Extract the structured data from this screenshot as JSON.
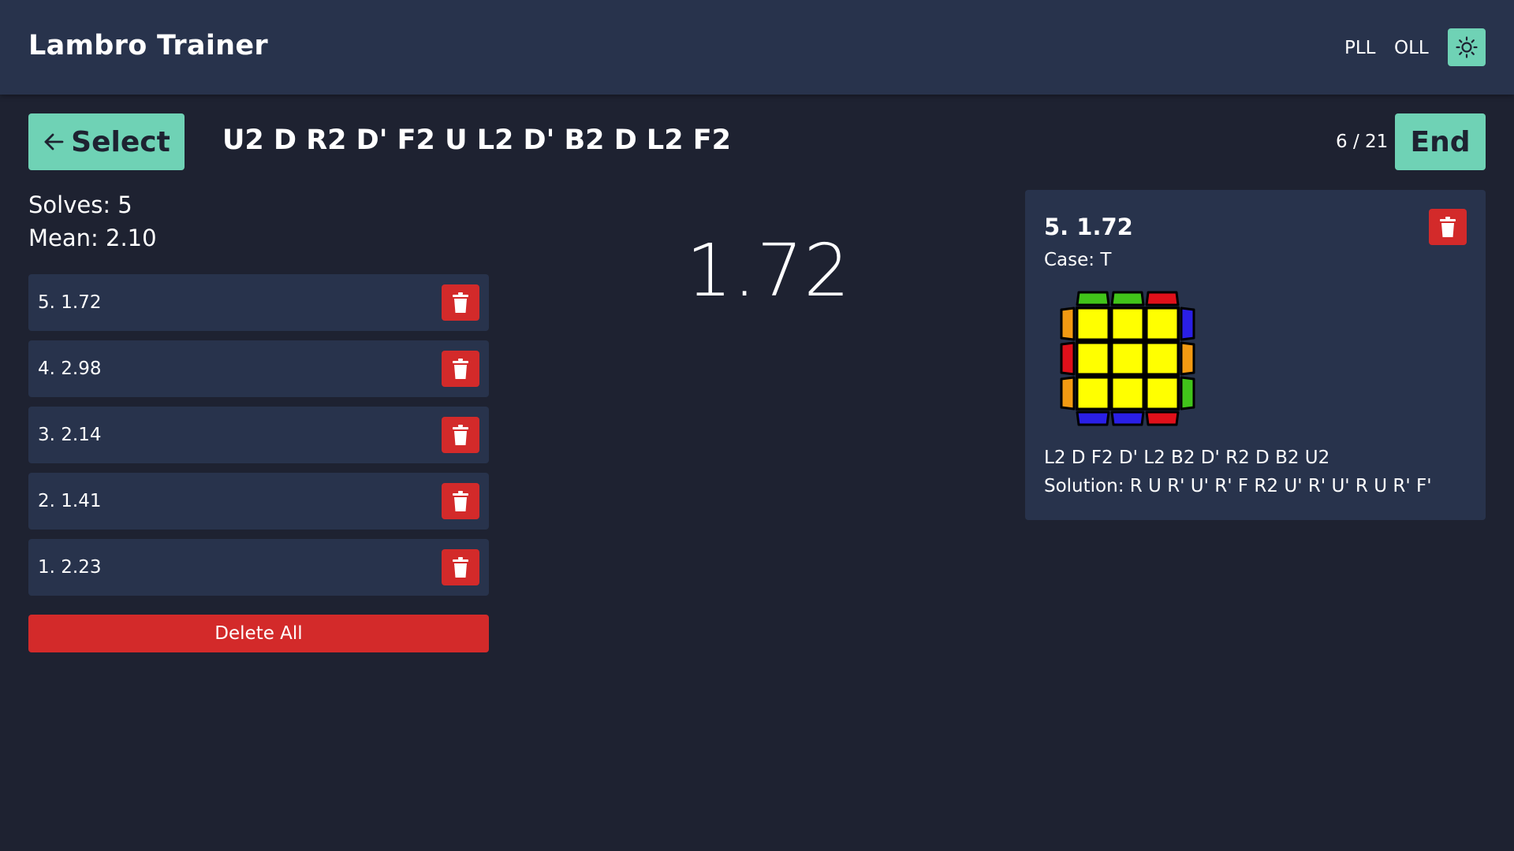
{
  "header": {
    "title": "Lambro Trainer",
    "nav": [
      "PLL",
      "OLL"
    ],
    "theme_icon": "sun-icon"
  },
  "toolbar": {
    "select_label": "Select",
    "scramble": "U2 D R2 D' F2 U L2 D' B2 D L2 F2",
    "counter": "6 / 21",
    "end_label": "End"
  },
  "stats": {
    "solves": "Solves: 5",
    "mean": "Mean: 2.10"
  },
  "solves": [
    {
      "label": "5. 1.72"
    },
    {
      "label": "4. 2.98"
    },
    {
      "label": "3. 2.14"
    },
    {
      "label": "2. 1.41"
    },
    {
      "label": "1. 2.23"
    }
  ],
  "delete_all_label": "Delete All",
  "timer": "1.72",
  "detail": {
    "title": "5. 1.72",
    "case": "Case: T",
    "scramble": "L2 D F2 D' L2 B2 D' R2 D B2 U2",
    "solution": "Solution: R U R' U' R' F R2 U' R' U' R U R' F'",
    "cube": {
      "top": [
        "#ffff00",
        "#ffff00",
        "#ffff00",
        "#ffff00",
        "#ffff00",
        "#ffff00",
        "#ffff00",
        "#ffff00",
        "#ffff00"
      ],
      "back": [
        "#41c41a",
        "#41c41a",
        "#e0101a"
      ],
      "front": [
        "#2a1fe6",
        "#2a1fe6",
        "#e0101a"
      ],
      "left": [
        "#f29a12",
        "#e0101a",
        "#f29a12"
      ],
      "right": [
        "#2a1fe6",
        "#f29a12",
        "#41c41a"
      ]
    }
  },
  "colors": {
    "accent": "#6fd2b5",
    "danger": "#d32a2a",
    "panel": "#28334c",
    "background": "#1e2231"
  }
}
